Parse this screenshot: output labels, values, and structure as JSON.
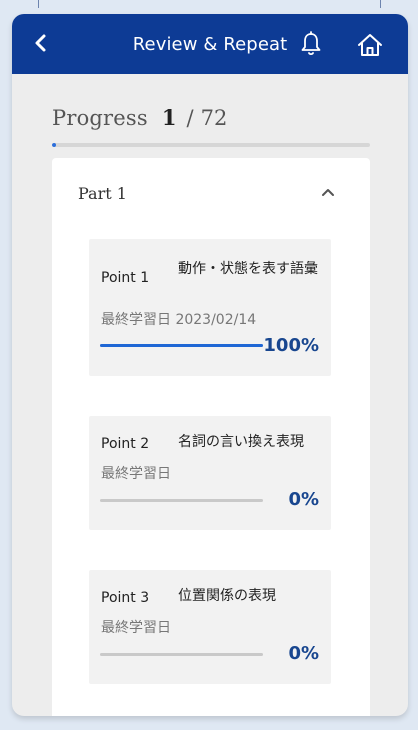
{
  "app": {
    "title": "Review & Repeat",
    "icons": {
      "back": "back-chevron-icon",
      "bell": "bell-icon",
      "home": "home-icon"
    },
    "colors": {
      "header": "#0d3b95",
      "accent": "#2b6edb",
      "percent_text": "#18468f",
      "background": "#ededed",
      "card": "#ffffff"
    }
  },
  "progress": {
    "label": "Progress",
    "current": "1",
    "separator": "/",
    "total": "72",
    "fraction": 0.0139
  },
  "part": {
    "title": "Part 1",
    "expanded": true,
    "toggle_icon": "chevron-up-icon",
    "points": [
      {
        "label": "Point 1",
        "topic": "動作・状態を表す語彙",
        "last_studied_label": "最終学習日",
        "last_studied_date": "2023/02/14",
        "percent_text": "100%",
        "progress": 1.0
      },
      {
        "label": "Point 2",
        "topic": "名詞の言い換え表現",
        "last_studied_label": "最終学習日",
        "last_studied_date": "",
        "percent_text": "0%",
        "progress": 0.0
      },
      {
        "label": "Point 3",
        "topic": "位置関係の表現",
        "last_studied_label": "最終学習日",
        "last_studied_date": "",
        "percent_text": "0%",
        "progress": 0.0
      }
    ]
  }
}
